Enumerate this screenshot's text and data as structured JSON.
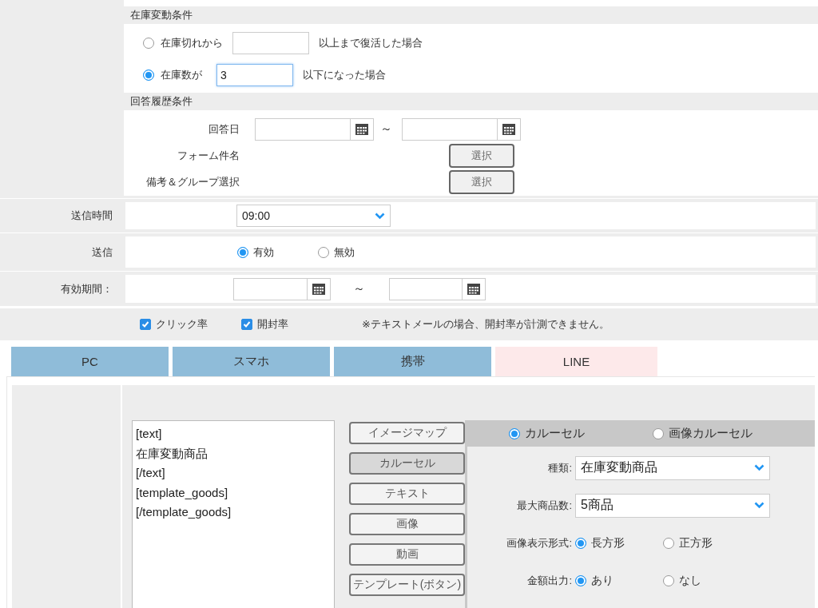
{
  "stock_condition": {
    "title": "在庫変動条件",
    "options": [
      {
        "label": "在庫切れから",
        "suffix": "以上まで復活した場合",
        "selected": false,
        "focused": false
      },
      {
        "label": "在庫数が",
        "value": "3",
        "suffix": "以下になった場合",
        "selected": true,
        "focused": true
      }
    ]
  },
  "answer_condition": {
    "title": "回答履歴条件",
    "rows": [
      {
        "kind": "date_range",
        "label": "回答日",
        "separator": "～"
      },
      {
        "kind": "select_button",
        "label": "フォーム件名",
        "button": "選択"
      },
      {
        "kind": "select_button",
        "label": "備考＆グループ選択",
        "button": "選択"
      }
    ]
  },
  "send_time": {
    "label": "送信時間",
    "value": "09:00"
  },
  "send": {
    "label": "送信",
    "options": [
      {
        "label": "有効",
        "selected": true
      },
      {
        "label": "無効",
        "selected": false
      }
    ]
  },
  "validity": {
    "label": "有効期間：",
    "separator": "～"
  },
  "tracking": {
    "options": [
      {
        "label": "クリック率",
        "checked": true
      },
      {
        "label": "開封率",
        "checked": true
      }
    ],
    "note": "※テキストメールの場合、開封率が計測できません。"
  },
  "tabs": [
    {
      "label": "PC",
      "selected": false
    },
    {
      "label": "スマホ",
      "selected": false
    },
    {
      "label": "携帯",
      "selected": false
    },
    {
      "label": "LINE",
      "selected": true
    }
  ],
  "editor": {
    "lines": [
      "[text]",
      "在庫変動商品",
      "[/text]",
      "[template_goods]",
      "[/template_goods]"
    ]
  },
  "insert_buttons": [
    {
      "label": "イメージマップ",
      "selected": false
    },
    {
      "label": "カルーセル",
      "selected": true
    },
    {
      "label": "テキスト",
      "selected": false
    },
    {
      "label": "画像",
      "selected": false
    },
    {
      "label": "動画",
      "selected": false
    },
    {
      "label": "テンプレート(ボタン)",
      "selected": false
    }
  ],
  "carousel": {
    "types": [
      {
        "label": "カルーセル",
        "selected": true
      },
      {
        "label": "画像カルーセル",
        "selected": false
      }
    ],
    "fields": [
      {
        "kind": "select",
        "label": "種類:",
        "value": "在庫変動商品"
      },
      {
        "kind": "select",
        "label": "最大商品数:",
        "value": "5商品"
      },
      {
        "kind": "radio",
        "label": "画像表示形式:",
        "options": [
          {
            "label": "長方形",
            "selected": true
          },
          {
            "label": "正方形",
            "selected": false
          }
        ]
      },
      {
        "kind": "radio",
        "label": "金額出力:",
        "options": [
          {
            "label": "あり",
            "selected": true
          },
          {
            "label": "なし",
            "selected": false
          }
        ]
      }
    ]
  }
}
